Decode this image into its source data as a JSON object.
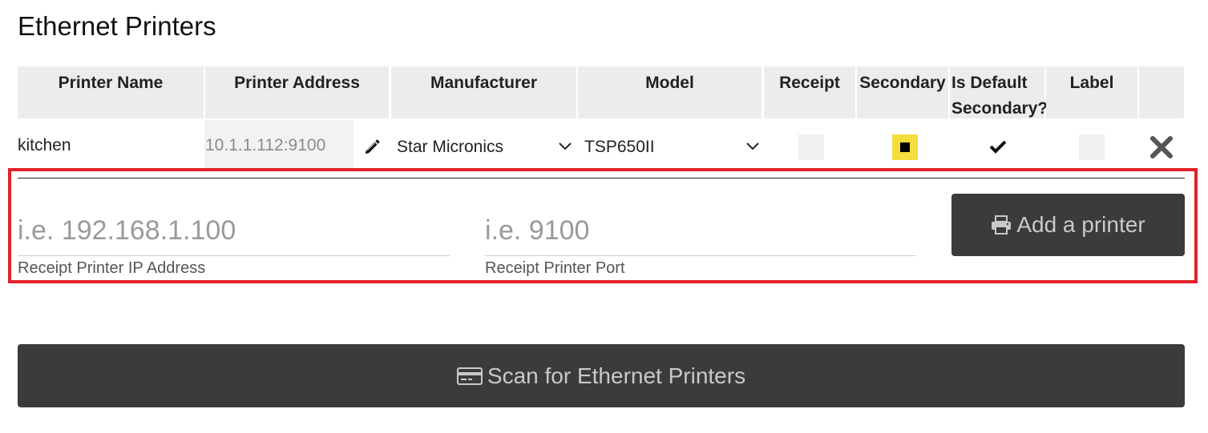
{
  "page": {
    "title": "Ethernet Printers"
  },
  "table": {
    "headers": [
      "Printer Name",
      "Printer Address",
      "Manufacturer",
      "Model",
      "Receipt",
      "Secondary",
      "Is Default Secondary?",
      "Label",
      ""
    ],
    "rows": [
      {
        "name": "kitchen",
        "address": "10.1.1.112:9100",
        "manufacturer": "Star Micronics",
        "model": "TSP650II",
        "receipt": false,
        "secondary": true,
        "is_default_secondary": true,
        "label": false
      }
    ]
  },
  "add_form": {
    "ip_placeholder": "i.e. 192.168.1.100",
    "ip_value": "",
    "ip_label": "Receipt Printer IP Address",
    "port_placeholder": "i.e. 9100",
    "port_value": "",
    "port_label": "Receipt Printer Port",
    "add_button_label": "Add a printer"
  },
  "scan_button_label": "Scan for Ethernet Printers",
  "icons": {
    "edit": "pencil-icon",
    "dropdown": "chevron-down-icon",
    "default_check": "check-icon",
    "delete": "close-icon",
    "add": "printer-icon",
    "scan": "credit-card-icon"
  },
  "colors": {
    "highlight_border": "#e3222a",
    "secondary_checkbox": "#f3dd3c",
    "button_background": "#3b3b3b",
    "header_background": "#ececec"
  }
}
